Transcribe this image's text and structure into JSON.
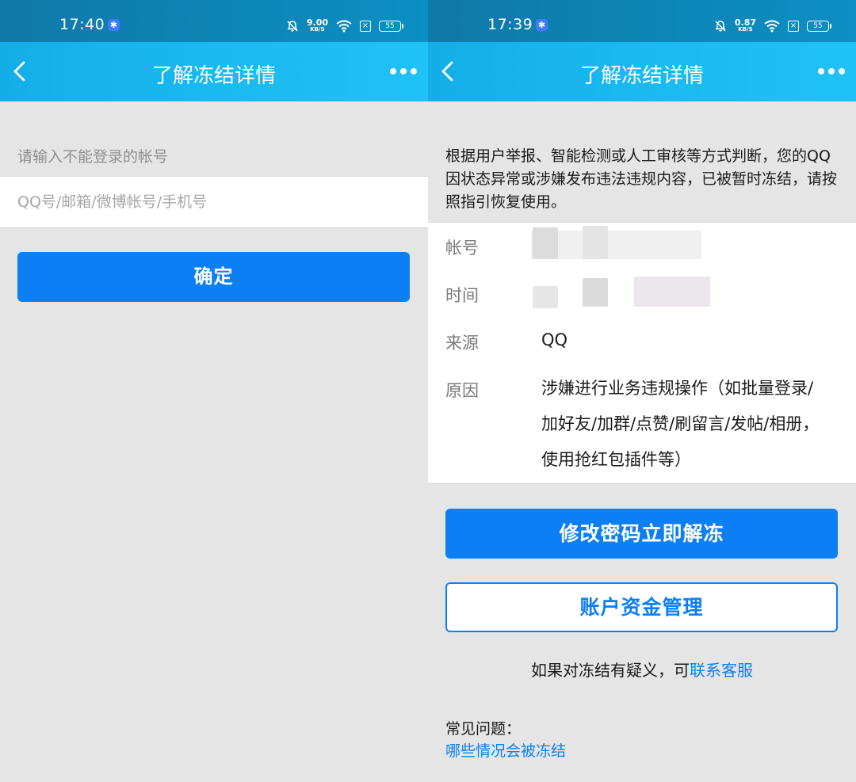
{
  "left_screen": {
    "status_bar": {
      "time": "17:40",
      "speed_value": "9.00",
      "speed_unit": "KB/S",
      "battery": "55"
    },
    "header": {
      "title": "了解冻结详情"
    },
    "account_label": "请输入不能登录的帐号",
    "account_input": {
      "placeholder": "QQ号/邮箱/微博帐号/手机号",
      "value": ""
    },
    "confirm_button": "确定"
  },
  "right_screen": {
    "status_bar": {
      "time": "17:39",
      "speed_value": "0.87",
      "speed_unit": "KB/S",
      "battery": "55"
    },
    "header": {
      "title": "了解冻结详情"
    },
    "notice": "根据用户举报、智能检测或人工审核等方式判断，您的QQ因状态异常或涉嫌发布违法违规内容，已被暂时冻结，请按照指引恢复使用。",
    "details": {
      "account_label": "帐号",
      "time_label": "时间",
      "source_label": "来源",
      "source_value": "QQ",
      "reason_label": "原因",
      "reason_value": "涉嫌进行业务违规操作（如批量登录/加好友/加群/点赞/刷留言/发帖/相册，使用抢红包插件等）"
    },
    "unfreeze_button": "修改密码立即解冻",
    "funds_button": "账户资金管理",
    "contact_prefix": "如果对冻结有疑义，可",
    "contact_link": "联系客服",
    "faq_title": "常见问题：",
    "faq_link": "哪些情况会被冻结"
  },
  "colors": {
    "primary": "#0d7ff5",
    "header_gradient_start": "#13aee8",
    "header_gradient_end": "#1fc2f6",
    "status_bar": "#0f79a8",
    "background": "#e5e5e5"
  },
  "icons": [
    "back-arrow-icon",
    "more-dots-icon",
    "app-badge-icon",
    "mute-bell-icon",
    "wifi-icon",
    "sim-x-icon",
    "battery-icon"
  ]
}
